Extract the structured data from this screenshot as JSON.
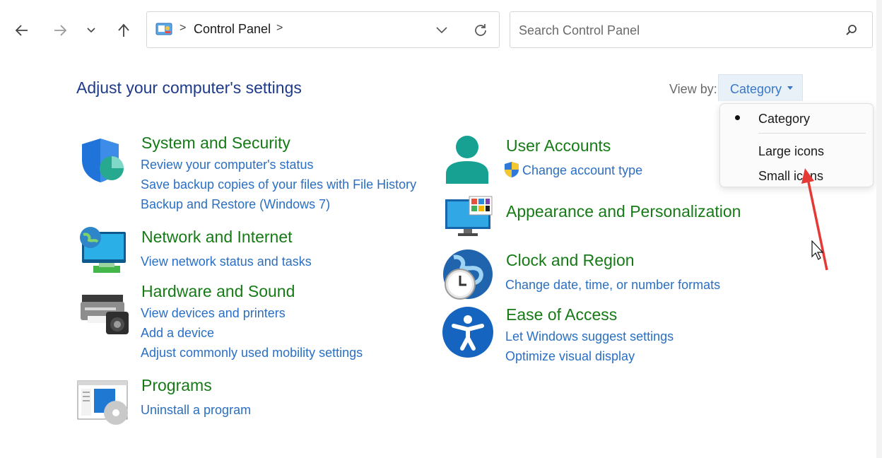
{
  "nav": {
    "back": "back-arrow-icon",
    "forward": "forward-arrow-icon",
    "recent": "chevron-down-icon",
    "up": "up-arrow-icon"
  },
  "address": {
    "crumb": "Control Panel",
    "separator": ">"
  },
  "search": {
    "placeholder": "Search Control Panel"
  },
  "main": {
    "heading": "Adjust your computer's settings",
    "view_by_label": "View by:",
    "view_by_value": "Category"
  },
  "view_menu": {
    "items": [
      "Category",
      "Large icons",
      "Small icons"
    ],
    "selected": "Category"
  },
  "categories": [
    {
      "title": "System and Security",
      "icon": "shield-icon",
      "links": [
        "Review your computer's status",
        "Save backup copies of your files with File History",
        "Backup and Restore (Windows 7)"
      ]
    },
    {
      "title": "Network and Internet",
      "icon": "network-icon",
      "links": [
        "View network status and tasks"
      ]
    },
    {
      "title": "Hardware and Sound",
      "icon": "printer-icon",
      "links": [
        "View devices and printers",
        "Add a device",
        "Adjust commonly used mobility settings"
      ]
    },
    {
      "title": "Programs",
      "icon": "programs-icon",
      "links": [
        "Uninstall a program"
      ]
    },
    {
      "title": "User Accounts",
      "icon": "user-icon",
      "links": [
        "Change account type"
      ]
    },
    {
      "title": "Appearance and Personalization",
      "icon": "monitor-icon",
      "links": []
    },
    {
      "title": "Clock and Region",
      "icon": "clock-globe-icon",
      "links": [
        "Change date, time, or number formats"
      ]
    },
    {
      "title": "Ease of Access",
      "icon": "accessibility-icon",
      "links": [
        "Let Windows suggest settings",
        "Optimize visual display"
      ]
    }
  ],
  "colors": {
    "category_title": "#167a16",
    "link": "#2a6fc3",
    "heading": "#1e3a8a",
    "annotation_arrow": "#e53935"
  }
}
